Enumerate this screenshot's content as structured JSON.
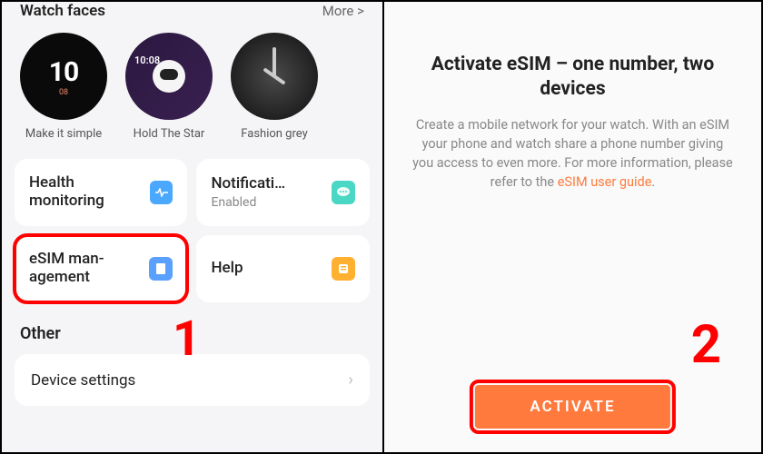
{
  "left": {
    "header": {
      "title": "Watch faces",
      "more": "More >"
    },
    "faces": [
      {
        "big": "10",
        "small": "08",
        "label": "Make it simple"
      },
      {
        "time": "10:08",
        "label": "Hold The Star"
      },
      {
        "label": "Fashion grey"
      }
    ],
    "tiles": {
      "health": {
        "title": "Health monitoring"
      },
      "notif": {
        "title": "Notificati…",
        "sub": "Enabled"
      },
      "esim": {
        "title": "eSIM man-\nagement"
      },
      "help": {
        "title": "Help"
      }
    },
    "other_label": "Other",
    "device_settings": "Device settings",
    "annot1": "1"
  },
  "right": {
    "heading": "Activate eSIM – one number, two devices",
    "desc_pre": "Create a mobile network for your watch. With an eSIM your phone and watch share a phone number giving you access to even more. For more information, please refer to the ",
    "desc_link": "eSIM user guide",
    "desc_post": ".",
    "activate": "ACTIVATE",
    "annot2": "2"
  }
}
